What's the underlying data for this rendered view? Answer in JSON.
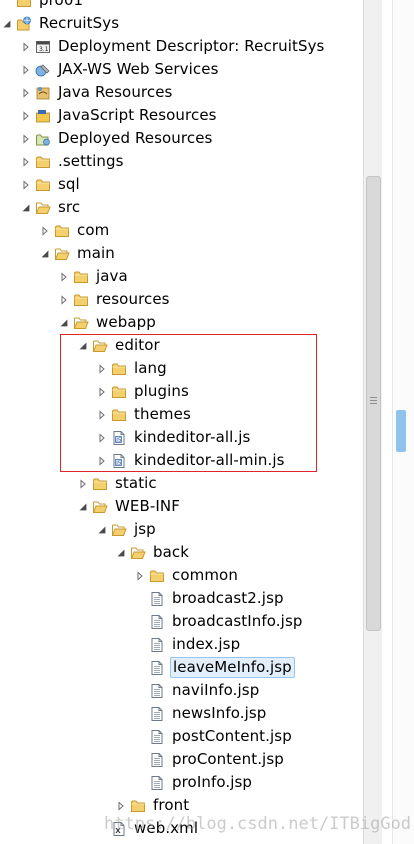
{
  "tree": {
    "nodes": [
      {
        "label": "pro01",
        "depth": 0,
        "twisty": "none",
        "icon": "folder-icon"
      },
      {
        "label": "RecruitSys",
        "depth": 0,
        "twisty": "expanded",
        "icon": "web-project-icon"
      },
      {
        "label": "Deployment Descriptor: RecruitSys",
        "depth": 1,
        "twisty": "collapsed",
        "icon": "deployment-descriptor-icon"
      },
      {
        "label": "JAX-WS Web Services",
        "depth": 1,
        "twisty": "collapsed",
        "icon": "web-services-icon"
      },
      {
        "label": "Java Resources",
        "depth": 1,
        "twisty": "collapsed",
        "icon": "java-resources-icon"
      },
      {
        "label": "JavaScript Resources",
        "depth": 1,
        "twisty": "collapsed",
        "icon": "javascript-resources-icon"
      },
      {
        "label": "Deployed Resources",
        "depth": 1,
        "twisty": "collapsed",
        "icon": "deployed-resources-icon"
      },
      {
        "label": ".settings",
        "depth": 1,
        "twisty": "collapsed",
        "icon": "folder-icon"
      },
      {
        "label": "sql",
        "depth": 1,
        "twisty": "collapsed",
        "icon": "folder-icon"
      },
      {
        "label": "src",
        "depth": 1,
        "twisty": "expanded",
        "icon": "folder-open-icon"
      },
      {
        "label": "com",
        "depth": 2,
        "twisty": "collapsed",
        "icon": "folder-icon"
      },
      {
        "label": "main",
        "depth": 2,
        "twisty": "expanded",
        "icon": "folder-open-icon"
      },
      {
        "label": "java",
        "depth": 3,
        "twisty": "collapsed",
        "icon": "folder-icon"
      },
      {
        "label": "resources",
        "depth": 3,
        "twisty": "collapsed",
        "icon": "folder-icon"
      },
      {
        "label": "webapp",
        "depth": 3,
        "twisty": "expanded",
        "icon": "folder-open-icon"
      },
      {
        "label": "editor",
        "depth": 4,
        "twisty": "expanded",
        "icon": "folder-open-icon"
      },
      {
        "label": "lang",
        "depth": 5,
        "twisty": "collapsed",
        "icon": "folder-icon"
      },
      {
        "label": "plugins",
        "depth": 5,
        "twisty": "collapsed",
        "icon": "folder-icon"
      },
      {
        "label": "themes",
        "depth": 5,
        "twisty": "collapsed",
        "icon": "folder-icon"
      },
      {
        "label": "kindeditor-all.js",
        "depth": 5,
        "twisty": "collapsed",
        "icon": "js-file-icon"
      },
      {
        "label": "kindeditor-all-min.js",
        "depth": 5,
        "twisty": "collapsed",
        "icon": "js-file-icon"
      },
      {
        "label": "static",
        "depth": 4,
        "twisty": "collapsed",
        "icon": "folder-icon"
      },
      {
        "label": "WEB-INF",
        "depth": 4,
        "twisty": "expanded",
        "icon": "folder-open-icon"
      },
      {
        "label": "jsp",
        "depth": 5,
        "twisty": "expanded",
        "icon": "folder-open-icon"
      },
      {
        "label": "back",
        "depth": 6,
        "twisty": "expanded",
        "icon": "folder-open-icon"
      },
      {
        "label": "common",
        "depth": 7,
        "twisty": "collapsed",
        "icon": "folder-icon"
      },
      {
        "label": "broadcast2.jsp",
        "depth": 7,
        "twisty": "none",
        "icon": "jsp-file-icon"
      },
      {
        "label": "broadcastInfo.jsp",
        "depth": 7,
        "twisty": "none",
        "icon": "jsp-file-icon"
      },
      {
        "label": "index.jsp",
        "depth": 7,
        "twisty": "none",
        "icon": "jsp-file-icon"
      },
      {
        "label": "leaveMeInfo.jsp",
        "depth": 7,
        "twisty": "none",
        "icon": "jsp-file-icon",
        "selected": true
      },
      {
        "label": "naviInfo.jsp",
        "depth": 7,
        "twisty": "none",
        "icon": "jsp-file-icon"
      },
      {
        "label": "newsInfo.jsp",
        "depth": 7,
        "twisty": "none",
        "icon": "jsp-file-icon"
      },
      {
        "label": "postContent.jsp",
        "depth": 7,
        "twisty": "none",
        "icon": "jsp-file-icon"
      },
      {
        "label": "proContent.jsp",
        "depth": 7,
        "twisty": "none",
        "icon": "jsp-file-icon"
      },
      {
        "label": "proInfo.jsp",
        "depth": 7,
        "twisty": "none",
        "icon": "jsp-file-icon"
      },
      {
        "label": "front",
        "depth": 6,
        "twisty": "collapsed",
        "icon": "folder-icon"
      },
      {
        "label": "web.xml",
        "depth": 5,
        "twisty": "none",
        "icon": "xml-file-icon"
      }
    ]
  },
  "watermark": "https://blog.csdn.net/ITBigGod",
  "colors": {
    "folder_fill": "#f4cf6d",
    "folder_stroke": "#c79a2f",
    "twisty": "#6e6e6e",
    "selection_bg": "#e3eefb",
    "selection_border": "#99c5f0",
    "highlight_box": "#e0262b",
    "outer_scroll_thumb": "#8fc3ee"
  }
}
